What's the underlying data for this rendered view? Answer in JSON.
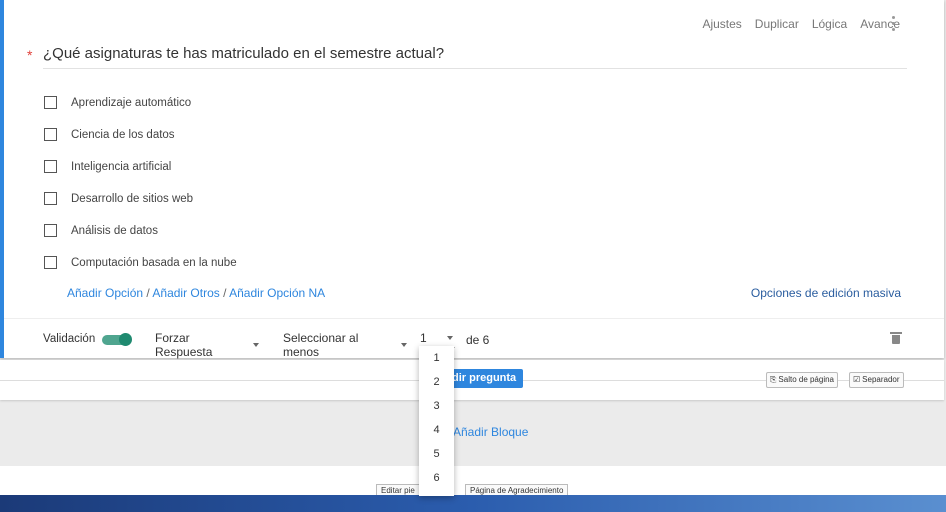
{
  "toolbar": {
    "settings": "Ajustes",
    "duplicate": "Duplicar",
    "logic": "Lógica",
    "advanced": "Avance"
  },
  "question": {
    "required_marker": "*",
    "text": "¿Qué asignaturas te has matriculado en el semestre actual?"
  },
  "options": [
    "Aprendizaje automático",
    "Ciencia de los datos",
    "Inteligencia artificial",
    "Desarrollo de sitios web",
    "Análisis de datos",
    "Computación basada en la nube"
  ],
  "links": {
    "add_option": "Añadir Opción",
    "add_others": "Añadir Otros",
    "add_na": "Añadir Opción NA",
    "separator": "/",
    "bulk_edit": "Opciones de edición masiva"
  },
  "validation": {
    "label": "Validación",
    "enabled": true,
    "force_response": "Forzar Respuesta",
    "select_at_least": "Seleccionar al menos",
    "count": "1",
    "of_total": "de 6"
  },
  "dropdown_options": [
    "1",
    "2",
    "3",
    "4",
    "5",
    "6"
  ],
  "actions": {
    "add_question": "dir pregunta",
    "page_break": "Salto de página",
    "separator": "Separador",
    "add_block": "Añadir Bloque",
    "edit_footer": "Editar pie",
    "thanks_page": "Página de Agradecimiento"
  },
  "colors": {
    "accent": "#2e86de",
    "required": "#e0403a",
    "toggle": "#1f8a70"
  }
}
